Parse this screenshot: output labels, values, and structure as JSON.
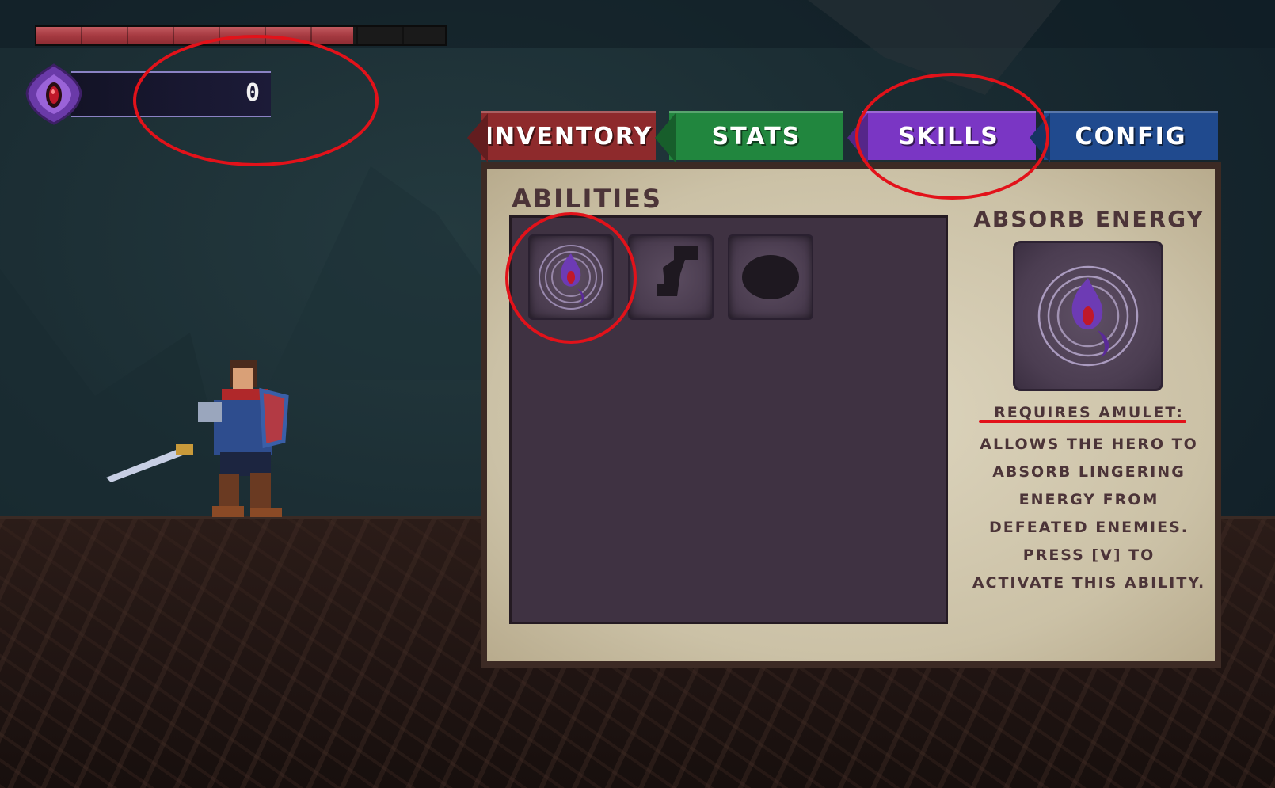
{
  "hud": {
    "health_fraction": 0.775,
    "energy_count": "0",
    "energy_icon": "eye-amulet-icon"
  },
  "menu": {
    "tabs": [
      {
        "label": "INVENTORY",
        "color": "#8e2a2c"
      },
      {
        "label": "STATS",
        "color": "#21863e"
      },
      {
        "label": "SKILLS",
        "color": "#7a36c4",
        "active": true
      },
      {
        "label": "CONFIG",
        "color": "#204a8e"
      }
    ]
  },
  "abilities": {
    "title": "ABILITIES",
    "slots": [
      {
        "icon": "absorb-energy-icon",
        "unlocked": true
      },
      {
        "icon": "dash-silhouette-icon",
        "unlocked": false
      },
      {
        "icon": "orb-silhouette-icon",
        "unlocked": false
      }
    ]
  },
  "detail": {
    "title": "ABSORB ENERGY",
    "requires": "REQUIRES AMULET:",
    "description": "ALLOWS THE HERO TO\nABSORB LINGERING\nENERGY FROM\nDEFEATED ENEMIES.\nPRESS [V] TO\nACTIVATE THIS ABILITY."
  },
  "colors": {
    "annotation": "#e2121a",
    "panel_text": "#4c3438",
    "health": "#a63a41"
  }
}
